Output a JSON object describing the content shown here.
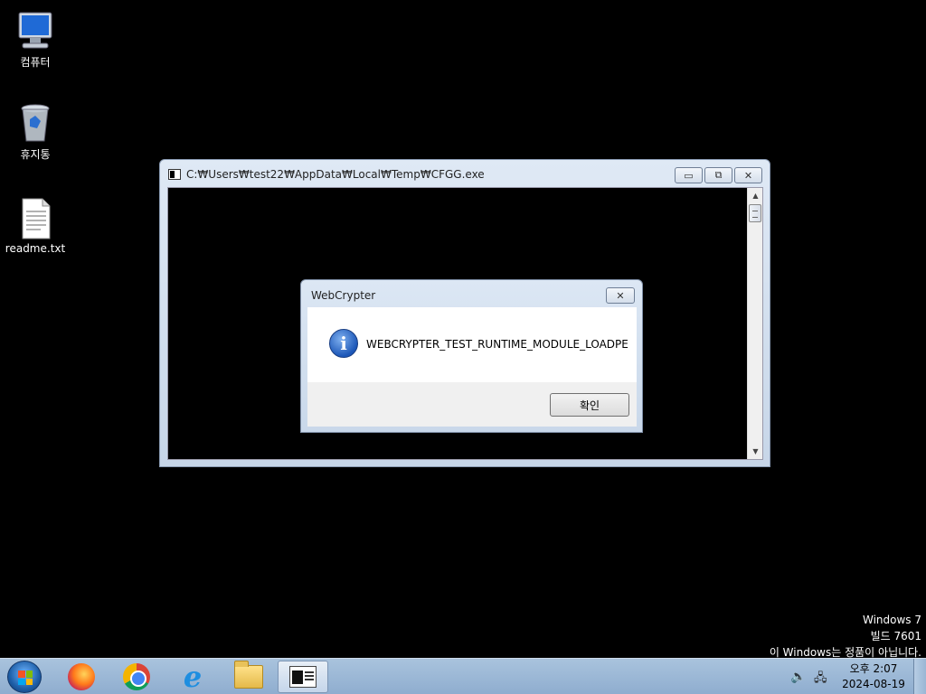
{
  "desktop": {
    "icons": [
      {
        "label": "컴퓨터",
        "icon": "computer-icon"
      },
      {
        "label": "휴지통",
        "icon": "recycle-bin-icon"
      },
      {
        "label": "readme.txt",
        "icon": "text-file-icon"
      }
    ]
  },
  "console_window": {
    "title": "C:₩Users₩test22₩AppData₩Local₩Temp₩CFGG.exe",
    "minimize_glyph": "▭",
    "maximize_glyph": "⧉",
    "close_glyph": "✕"
  },
  "message_box": {
    "title": "WebCrypter",
    "message": "WEBCRYPTER_TEST_RUNTIME_MODULE_LOADPE",
    "ok_label": "확인",
    "close_glyph": "✕",
    "icon": "info-icon"
  },
  "watermark": {
    "line1": "Windows 7",
    "line2": "빌드 7601",
    "line3": "이 Windows는 정품이 아닙니다."
  },
  "taskbar": {
    "apps": [
      "firefox-icon",
      "chrome-icon",
      "internet-explorer-icon",
      "file-explorer-icon",
      "console-icon"
    ],
    "ie_glyph": "e",
    "volume_glyph": "🔈",
    "network_glyph": "🖧",
    "clock_time": "오후 2:07",
    "clock_date": "2024-08-19"
  },
  "colors": {
    "desktop_bg": "#000000",
    "taskbar_bg": "#a9c3dd",
    "console_bg": "#000000"
  }
}
